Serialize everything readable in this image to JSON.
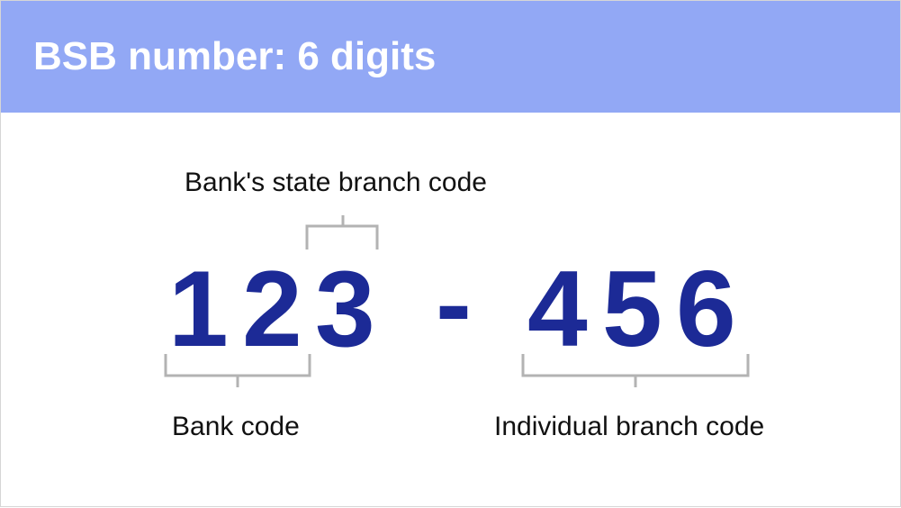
{
  "header": {
    "title": "BSB number: 6 digits"
  },
  "diagram": {
    "digits": [
      "1",
      "2",
      "3",
      "4",
      "5",
      "6"
    ],
    "separator": "-",
    "labels": {
      "state_branch": "Bank's state branch code",
      "bank_code": "Bank code",
      "individual_branch": "Individual branch code"
    },
    "colors": {
      "header_background": "#92a8f5",
      "title_text": "#ffffff",
      "digit_text": "#1c2a96",
      "bracket": "#b3b3b3",
      "label_text": "#111111"
    }
  }
}
